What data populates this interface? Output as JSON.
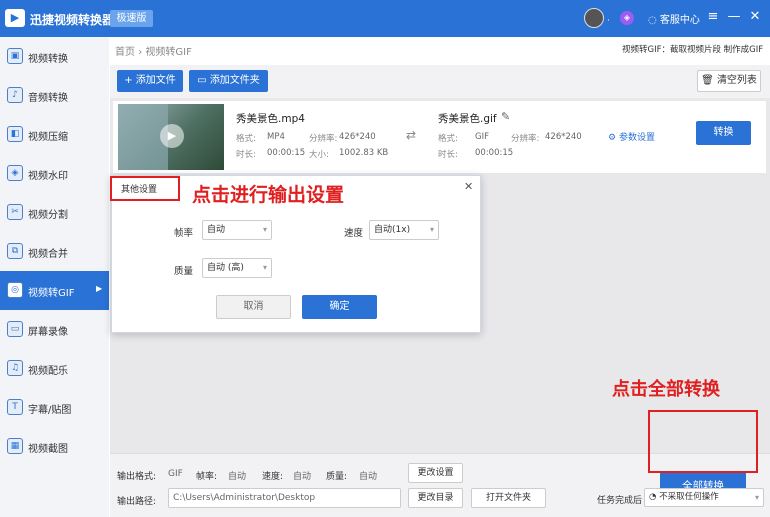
{
  "titlebar": {
    "logo_glyph": "▶",
    "app_title": "迅捷视频转换器",
    "edition": "极速版",
    "avatar_suffix": "·",
    "vip_glyph": "◈",
    "service": "客服中心",
    "service_icon": "chat-icon",
    "controls": [
      "≡",
      "—",
      "✕"
    ]
  },
  "sidebar": {
    "items": [
      {
        "label": "视频转换",
        "icon": "video-convert-icon",
        "glyph": "▣"
      },
      {
        "label": "音频转换",
        "icon": "audio-convert-icon",
        "glyph": "♪"
      },
      {
        "label": "视频压缩",
        "icon": "compress-icon",
        "glyph": "◧"
      },
      {
        "label": "视频水印",
        "icon": "watermark-icon",
        "glyph": "◈"
      },
      {
        "label": "视频分割",
        "icon": "split-icon",
        "glyph": "✂"
      },
      {
        "label": "视频合并",
        "icon": "merge-icon",
        "glyph": "⧉"
      },
      {
        "label": "视频转GIF",
        "icon": "gif-icon",
        "glyph": "◎",
        "active": true,
        "arrow": "▶"
      },
      {
        "label": "屏幕录像",
        "icon": "screen-record-icon",
        "glyph": "▭"
      },
      {
        "label": "视频配乐",
        "icon": "music-icon",
        "glyph": "♫"
      },
      {
        "label": "字幕/贴图",
        "icon": "subtitle-icon",
        "glyph": "T"
      },
      {
        "label": "视频截图",
        "icon": "screenshot-icon",
        "glyph": "▦"
      }
    ]
  },
  "breadcrumb": {
    "home": "首页",
    "sep": "›",
    "current": "视频转GIF"
  },
  "breadcrumb_right": "视频转GIF：截取视频片段 制作成GIF",
  "toolbar": {
    "add_file": "+ 添加文件",
    "add_folder": "添加文件夹",
    "folder_icon": "folder-icon",
    "clear_list": "清空列表",
    "trash_icon": "trash-icon"
  },
  "file": {
    "play_glyph": "▶",
    "src_name": "秀美景色.mp4",
    "src_format_label": "格式:",
    "src_format": "MP4",
    "src_res_label": "分辨率:",
    "src_res": "426*240",
    "src_dur_label": "时长:",
    "src_dur": "00:00:15",
    "src_size_label": "大小:",
    "src_size": "1002.83 KB",
    "arrow_glyph": "⇄",
    "out_name": "秀美景色.gif",
    "edit_glyph": "✎",
    "out_format_label": "格式:",
    "out_format": "GIF",
    "out_res_label": "分辨率:",
    "out_res": "426*240",
    "out_dur_label": "时长:",
    "out_dur": "00:00:15",
    "params_glyph": "⚙",
    "params": "参数设置",
    "convert": "转换"
  },
  "dialog": {
    "title": "其他设置",
    "close": "✕",
    "fps_label": "帧率",
    "fps_value": "自动",
    "speed_label": "速度",
    "speed_value": "自动(1x)",
    "quality_label": "质量",
    "quality_value": "自动 (高)",
    "caret": "▾",
    "cancel": "取消",
    "ok": "确定"
  },
  "annotations": {
    "output_settings": "点击进行输出设置",
    "convert_all": "点击全部转换"
  },
  "bottom": {
    "format_label": "输出格式:",
    "format_value": "GIF",
    "fps_label": "帧率:",
    "fps_value": "自动",
    "speed_label": "速度:",
    "speed_value": "自动",
    "quality_label": "质量:",
    "quality_value": "自动",
    "change_settings": "更改设置",
    "path_label": "输出路径:",
    "path_value": "C:\\Users\\Administrator\\Desktop",
    "change_dir": "更改目录",
    "open_folder": "打开文件夹",
    "convert_all": "全部转换"
  },
  "statusbar": {
    "after_task": "任务完成后",
    "action": "不采取任何操作",
    "action_glyph": "◔"
  },
  "colors": {
    "primary": "#2a72d6",
    "annotation": "#e02020"
  }
}
